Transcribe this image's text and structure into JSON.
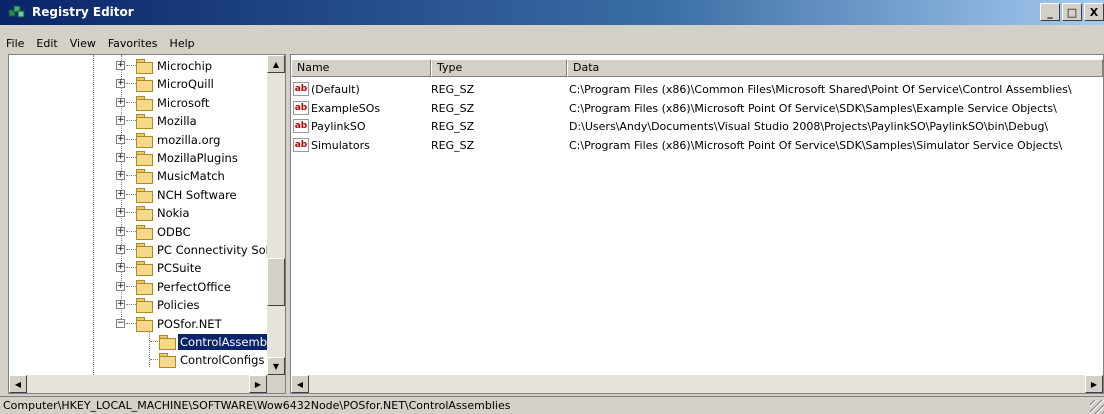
{
  "window": {
    "title": "Registry Editor",
    "buttons": {
      "minimize": "_",
      "maximize": "□",
      "close": "X"
    }
  },
  "menu": [
    "File",
    "Edit",
    "View",
    "Favorites",
    "Help"
  ],
  "tree": {
    "items": [
      {
        "label": "Microchip",
        "expander": "+",
        "selected": false
      },
      {
        "label": "MicroQuill",
        "expander": "+",
        "selected": false
      },
      {
        "label": "Microsoft",
        "expander": "+",
        "selected": false
      },
      {
        "label": "Mozilla",
        "expander": "+",
        "selected": false
      },
      {
        "label": "mozilla.org",
        "expander": "+",
        "selected": false
      },
      {
        "label": "MozillaPlugins",
        "expander": "+",
        "selected": false
      },
      {
        "label": "MusicMatch",
        "expander": "+",
        "selected": false
      },
      {
        "label": "NCH Software",
        "expander": "+",
        "selected": false
      },
      {
        "label": "Nokia",
        "expander": "+",
        "selected": false
      },
      {
        "label": "ODBC",
        "expander": "+",
        "selected": false
      },
      {
        "label": "PC Connectivity Sol",
        "expander": "+",
        "selected": false
      },
      {
        "label": "PCSuite",
        "expander": "+",
        "selected": false
      },
      {
        "label": "PerfectOffice",
        "expander": "+",
        "selected": false
      },
      {
        "label": "Policies",
        "expander": "+",
        "selected": false
      },
      {
        "label": "POSfor.NET",
        "expander": "−",
        "selected": false
      },
      {
        "label": "ControlAssembl",
        "expander": "",
        "selected": true
      },
      {
        "label": "ControlConfigs",
        "expander": "",
        "selected": false
      }
    ],
    "scroll_up_icon": "triangle-up",
    "scroll_down_icon": "triangle-down",
    "scroll_left_icon": "triangle-left",
    "scroll_right_icon": "triangle-right"
  },
  "list": {
    "columns": [
      "Name",
      "Type",
      "Data"
    ],
    "rows": [
      {
        "name": "(Default)",
        "type": "REG_SZ",
        "data": "C:\\Program Files (x86)\\Common Files\\Microsoft Shared\\Point Of Service\\Control Assemblies\\"
      },
      {
        "name": "ExampleSOs",
        "type": "REG_SZ",
        "data": "C:\\Program Files (x86)\\Microsoft Point Of Service\\SDK\\Samples\\Example Service Objects\\"
      },
      {
        "name": "PaylinkSO",
        "type": "REG_SZ",
        "data": "D:\\Users\\Andy\\Documents\\Visual Studio 2008\\Projects\\PaylinkSO\\PaylinkSO\\bin\\Debug\\"
      },
      {
        "name": "Simulators",
        "type": "REG_SZ",
        "data": "C:\\Program Files (x86)\\Microsoft Point Of Service\\SDK\\Samples\\Simulator Service Objects\\"
      }
    ],
    "value_icon_text": "ab"
  },
  "status": {
    "path": "Computer\\HKEY_LOCAL_MACHINE\\SOFTWARE\\Wow6432Node\\POSfor.NET\\ControlAssemblies"
  },
  "colors": {
    "title_gradient_start": "#0a246a",
    "selection": "#0a246a",
    "chrome": "#d4d0c8"
  }
}
